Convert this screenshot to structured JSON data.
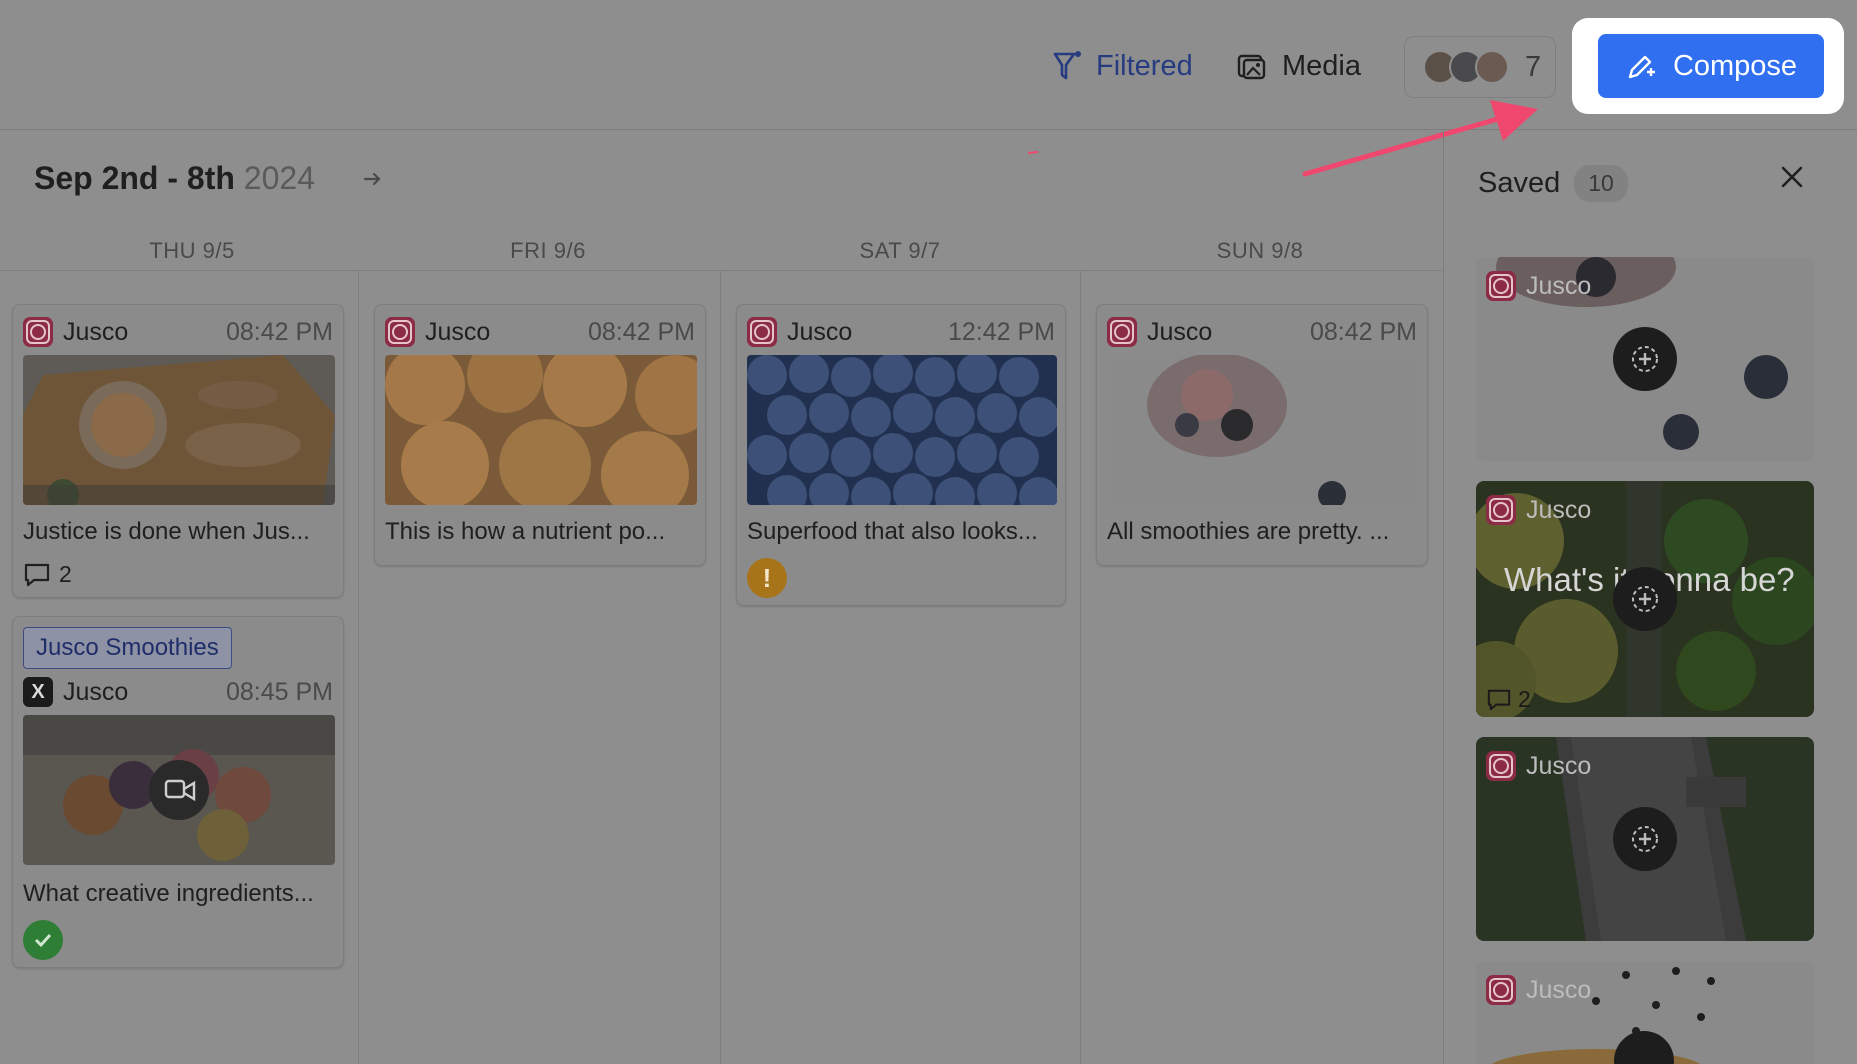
{
  "header": {
    "filtered_label": "Filtered",
    "media_label": "Media",
    "member_count": "7",
    "compose_label": "Compose"
  },
  "calendar": {
    "range_label": "Sep 2nd - 8th",
    "range_year": "2024",
    "days": [
      {
        "label": "THU 9/5"
      },
      {
        "label": "FRI 9/6"
      },
      {
        "label": "SAT 9/7"
      },
      {
        "label": "SUN 9/8"
      }
    ],
    "posts": [
      {
        "account": "Jusco",
        "time": "08:42 PM",
        "caption": "Justice is done when Jus...",
        "comments": "2",
        "network": "instagram-icon",
        "image": "grapefruit"
      },
      {
        "account": "Jusco",
        "time": "08:42 PM",
        "caption": "This is how a nutrient po...",
        "network": "instagram-icon",
        "image": "apricots"
      },
      {
        "account": "Jusco",
        "time": "12:42 PM",
        "caption": "Superfood that also looks...",
        "status": "warning",
        "network": "instagram-icon",
        "image": "blueberries"
      },
      {
        "account": "Jusco",
        "time": "08:42 PM",
        "caption": "All smoothies are pretty. ...",
        "network": "instagram-icon",
        "image": "smoothie-bowl"
      },
      {
        "tag": "Jusco Smoothies",
        "account": "Jusco",
        "time": "08:45 PM",
        "caption": "What creative ingredients...",
        "status": "approved",
        "network": "x-icon",
        "image": "smoothie-glasses"
      }
    ]
  },
  "saved": {
    "title": "Saved",
    "count": "10",
    "items": [
      {
        "account": "Jusco"
      },
      {
        "account": "Jusco",
        "overlay_text": "What's it gonna be?",
        "comments": "2"
      },
      {
        "account": "Jusco"
      },
      {
        "account": "Jusco"
      }
    ]
  },
  "colors": {
    "compose_blue": "#2f6ff0",
    "filtered_blue": "#263b80",
    "highlight": "#ffffff",
    "arrow_pink": "#f0476f"
  }
}
